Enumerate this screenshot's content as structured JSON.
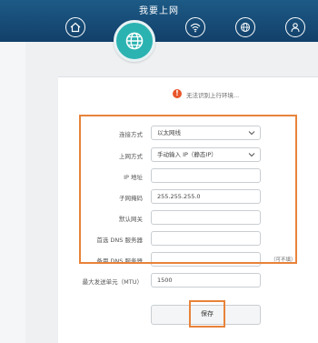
{
  "header": {
    "title": "我要上网"
  },
  "nav": {
    "items": [
      {
        "icon": "home-icon"
      },
      {
        "icon": "globe-icon",
        "active": true
      },
      {
        "icon": "wifi-icon"
      },
      {
        "icon": "network-icon"
      },
      {
        "icon": "user-icon"
      }
    ]
  },
  "status": {
    "warning_text": "无法识别上行环境..."
  },
  "form": {
    "connection_type_label": "连接方式",
    "connection_type_value": "以太网线",
    "internet_mode_label": "上网方式",
    "internet_mode_value": "手动输入 IP（静态IP）",
    "ip_label": "IP 地址",
    "ip_value": "",
    "mask_label": "子网掩码",
    "mask_value": "255.255.255.0",
    "gateway_label": "默认网关",
    "gateway_value": "",
    "dns1_label": "首选 DNS 服务器",
    "dns1_value": "",
    "dns2_label": "备用 DNS 服务器",
    "dns2_value": "",
    "dns2_hint": "（可不填）",
    "mtu_label": "最大发送单元（MTU）",
    "mtu_value": "1500",
    "save_label": "保存"
  },
  "colors": {
    "header": "#12406a",
    "accent": "#2bb3b1",
    "highlight": "#e8833a",
    "warning": "#e8562a"
  }
}
